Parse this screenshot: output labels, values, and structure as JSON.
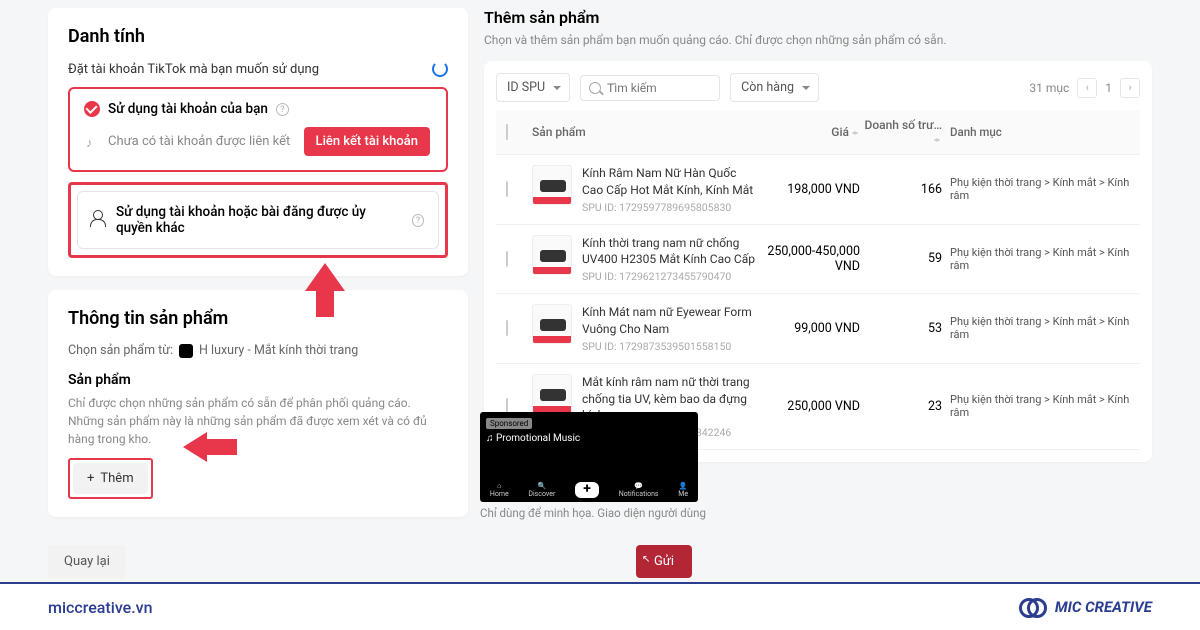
{
  "identity": {
    "title": "Danh tính",
    "set_account_label": "Đặt tài khoản TikTok mà bạn muốn sử dụng",
    "use_own_account": "Sử dụng tài khoản của bạn",
    "no_account_linked": "Chưa có tài khoản được liên kết",
    "link_account_btn": "Liên kết tài khoản",
    "use_authorized": "Sử dụng tài khoản hoặc bài đăng được ủy quyền khác"
  },
  "product_info": {
    "title": "Thông tin sản phẩm",
    "select_from": "Chọn sản phẩm từ:",
    "store_name": "H luxury - Mắt kính thời trang",
    "product_label": "Sản phẩm",
    "desc": "Chỉ được chọn những sản phẩm có sẵn để phân phối quảng cáo. Những sản phẩm này là những sản phẩm đã được xem xét và có đủ hàng trong kho.",
    "add_btn": "Thêm"
  },
  "add_products": {
    "title": "Thêm sản phẩm",
    "subtitle": "Chọn và thêm sản phẩm bạn muốn quảng cáo. Chỉ được chọn những sản phẩm có sẵn.",
    "filter_id": "ID SPU",
    "search_placeholder": "Tìm kiếm",
    "stock_filter": "Còn hàng",
    "item_count": "31 mục",
    "page": "1",
    "headers": {
      "product": "Sản phẩm",
      "price": "Giá",
      "sales": "Doanh số trư…",
      "category": "Danh mục"
    },
    "rows": [
      {
        "name": "Kính Râm Nam Nữ Hàn Quốc Cao Cấp Hot Mắt Kính, Kính Mắt",
        "spu": "SPU ID: 1729597789695805830",
        "price": "198,000 VND",
        "sales": "166",
        "category": "Phụ kiện thời trang > Kính mắt > Kính râm"
      },
      {
        "name": "Kính thời trang nam nữ chống UV400 H2305 Mắt Kính Cao Cấp",
        "spu": "SPU ID: 1729621273455790470",
        "price": "250,000-450,000 VND",
        "sales": "59",
        "category": "Phụ kiện thời trang > Kính mắt > Kính râm"
      },
      {
        "name": "Kính Mát nam nữ Eyewear Form Vuông Cho Nam",
        "spu": "SPU ID: 1729873539501558150",
        "price": "99,000 VND",
        "sales": "53",
        "category": "Phụ kiện thời trang > Kính mắt > Kính râm"
      },
      {
        "name": "Mắt kính râm nam nữ thời trang chống tia UV, kèm bao da đựng kính",
        "spu": "SPU ID: 1729972343374842246",
        "price": "250,000 VND",
        "sales": "23",
        "category": "Phụ kiện thời trang > Kính mắt > Kính râm"
      }
    ]
  },
  "tk_preview": {
    "sponsored": "Sponsored",
    "music": "♫ Promotional Music",
    "nav": [
      "Home",
      "Discover",
      "+",
      "Notifications",
      "Me"
    ],
    "caption": "Chỉ dùng để minh họa. Giao diện người dùng"
  },
  "bottom": {
    "back": "Quay lại",
    "send": "Gửi"
  },
  "footer": {
    "site": "miccreative.vn",
    "brand": "MIC CREATIVE"
  }
}
